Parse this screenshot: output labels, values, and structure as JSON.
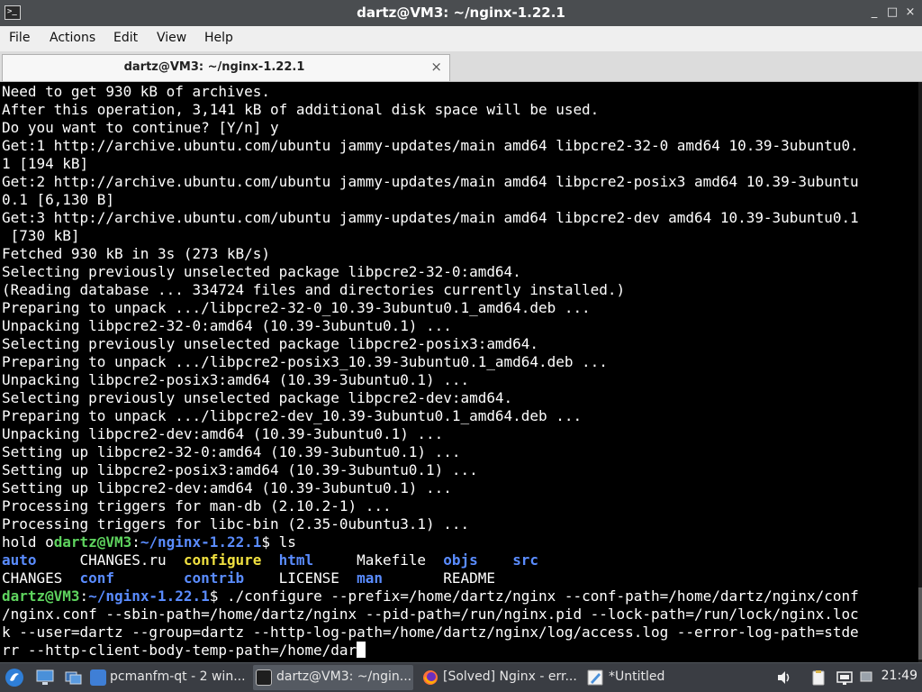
{
  "window": {
    "title": "dartz@VM3: ~/nginx-1.22.1",
    "controls": [
      "_",
      "□",
      "×"
    ]
  },
  "menu": {
    "items": [
      "File",
      "Actions",
      "Edit",
      "View",
      "Help"
    ]
  },
  "tab": {
    "label": "dartz@VM3: ~/nginx-1.22.1",
    "close": "×"
  },
  "terminal": {
    "lines": [
      [
        {
          "t": "Need to get 930 kB of archives."
        }
      ],
      [
        {
          "t": "After this operation, 3,141 kB of additional disk space will be used."
        }
      ],
      [
        {
          "t": "Do you want to continue? [Y/n] y"
        }
      ],
      [
        {
          "t": "Get:1 http://archive.ubuntu.com/ubuntu jammy-updates/main amd64 libpcre2-32-0 amd64 10.39-3ubuntu0."
        }
      ],
      [
        {
          "t": "1 [194 kB]"
        }
      ],
      [
        {
          "t": "Get:2 http://archive.ubuntu.com/ubuntu jammy-updates/main amd64 libpcre2-posix3 amd64 10.39-3ubuntu"
        }
      ],
      [
        {
          "t": "0.1 [6,130 B]"
        }
      ],
      [
        {
          "t": "Get:3 http://archive.ubuntu.com/ubuntu jammy-updates/main amd64 libpcre2-dev amd64 10.39-3ubuntu0.1"
        }
      ],
      [
        {
          "t": " [730 kB]"
        }
      ],
      [
        {
          "t": "Fetched 930 kB in 3s (273 kB/s)"
        }
      ],
      [
        {
          "t": "Selecting previously unselected package libpcre2-32-0:amd64."
        }
      ],
      [
        {
          "t": "(Reading database ... 334724 files and directories currently installed.)"
        }
      ],
      [
        {
          "t": "Preparing to unpack .../libpcre2-32-0_10.39-3ubuntu0.1_amd64.deb ..."
        }
      ],
      [
        {
          "t": "Unpacking libpcre2-32-0:amd64 (10.39-3ubuntu0.1) ..."
        }
      ],
      [
        {
          "t": "Selecting previously unselected package libpcre2-posix3:amd64."
        }
      ],
      [
        {
          "t": "Preparing to unpack .../libpcre2-posix3_10.39-3ubuntu0.1_amd64.deb ..."
        }
      ],
      [
        {
          "t": "Unpacking libpcre2-posix3:amd64 (10.39-3ubuntu0.1) ..."
        }
      ],
      [
        {
          "t": "Selecting previously unselected package libpcre2-dev:amd64."
        }
      ],
      [
        {
          "t": "Preparing to unpack .../libpcre2-dev_10.39-3ubuntu0.1_amd64.deb ..."
        }
      ],
      [
        {
          "t": "Unpacking libpcre2-dev:amd64 (10.39-3ubuntu0.1) ..."
        }
      ],
      [
        {
          "t": "Setting up libpcre2-32-0:amd64 (10.39-3ubuntu0.1) ..."
        }
      ],
      [
        {
          "t": "Setting up libpcre2-posix3:amd64 (10.39-3ubuntu0.1) ..."
        }
      ],
      [
        {
          "t": "Setting up libpcre2-dev:amd64 (10.39-3ubuntu0.1) ..."
        }
      ],
      [
        {
          "t": "Processing triggers for man-db (2.10.2-1) ..."
        }
      ],
      [
        {
          "t": "Processing triggers for libc-bin (2.35-0ubuntu3.1) ..."
        }
      ],
      [
        {
          "t": "hold o"
        },
        {
          "t": "dartz@VM3",
          "c": "green"
        },
        {
          "t": ":"
        },
        {
          "t": "~/nginx-1.22.1",
          "c": "blue"
        },
        {
          "t": "$ ls"
        }
      ],
      [
        {
          "t": "auto",
          "c": "blue"
        },
        {
          "t": "     CHANGES.ru  "
        },
        {
          "t": "configure",
          "c": "yellow"
        },
        {
          "t": "  "
        },
        {
          "t": "html",
          "c": "blue"
        },
        {
          "t": "     Makefile  "
        },
        {
          "t": "objs",
          "c": "blue"
        },
        {
          "t": "    "
        },
        {
          "t": "src",
          "c": "blue"
        }
      ],
      [
        {
          "t": "CHANGES  "
        },
        {
          "t": "conf",
          "c": "blue"
        },
        {
          "t": "        "
        },
        {
          "t": "contrib",
          "c": "blue"
        },
        {
          "t": "    LICENSE  "
        },
        {
          "t": "man",
          "c": "blue"
        },
        {
          "t": "       README"
        }
      ],
      [
        {
          "t": "dartz@VM3",
          "c": "green"
        },
        {
          "t": ":"
        },
        {
          "t": "~/nginx-1.22.1",
          "c": "blue"
        },
        {
          "t": "$ ./configure --prefix=/home/dartz/nginx --conf-path=/home/dartz/nginx/conf"
        }
      ],
      [
        {
          "t": "/nginx.conf --sbin-path=/home/dartz/nginx --pid-path=/run/nginx.pid --lock-path=/run/lock/nginx.loc"
        }
      ],
      [
        {
          "t": "k --user=dartz --group=dartz --http-log-path=/home/dartz/nginx/log/access.log --error-log-path=stde"
        }
      ],
      [
        {
          "t": "rr --http-client-body-temp-path=/home/dar"
        },
        {
          "cursor": true
        }
      ]
    ]
  },
  "taskbar": {
    "items": [
      {
        "label": "pcmanfm-qt - 2 win...",
        "icon": "folder-icon"
      },
      {
        "label": "dartz@VM3: ~/ngin...",
        "icon": "terminal-icon"
      },
      {
        "label": "[Solved] Nginx - err...",
        "icon": "firefox-icon"
      },
      {
        "label": "*Untitled",
        "icon": "text-editor-icon"
      }
    ],
    "clock": "21:49"
  }
}
